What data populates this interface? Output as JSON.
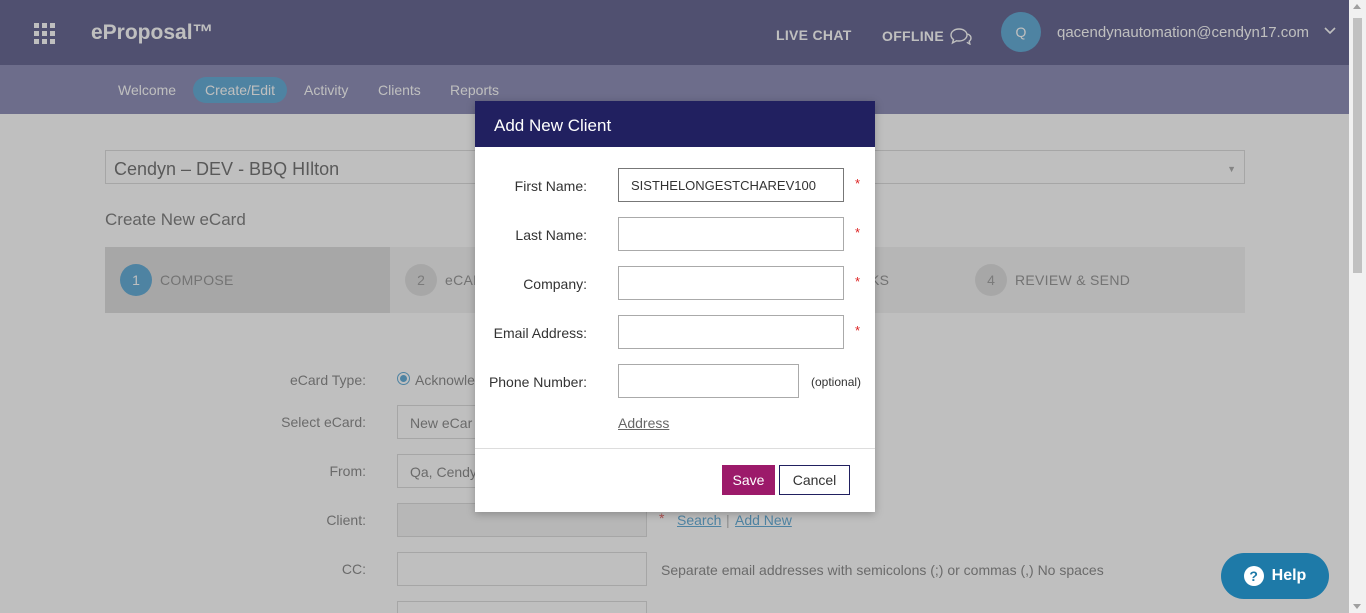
{
  "app": {
    "logo": "eProposal™"
  },
  "header": {
    "live_chat": "LIVE CHAT",
    "offline": "OFFLINE",
    "avatar_initial": "Q",
    "user_email": "qacendynautomation@cendyn17.com"
  },
  "nav": {
    "items": [
      {
        "label": "Welcome"
      },
      {
        "label": "Create/Edit",
        "active": true
      },
      {
        "label": "Activity"
      },
      {
        "label": "Clients"
      },
      {
        "label": "Reports"
      }
    ]
  },
  "property": {
    "selected": "Cendyn – DEV - BBQ HIlton"
  },
  "page": {
    "heading": "Create New eCard"
  },
  "steps": [
    {
      "num": "1",
      "label": "COMPOSE",
      "active": true
    },
    {
      "num": "2",
      "label": "eCAR"
    },
    {
      "num": "3",
      "label": "KS"
    },
    {
      "num": "4",
      "label": "REVIEW & SEND"
    }
  ],
  "form": {
    "ecard_type_label": "eCard Type:",
    "ecard_type_value": "Acknowle",
    "select_ecard_label": "Select eCard:",
    "select_ecard_value": "New eCar",
    "from_label": "From:",
    "from_value": "Qa, Cendy",
    "client_label": "Client:",
    "client_search": "Search",
    "client_separator": "|",
    "client_add_new": "Add New",
    "cc_label": "CC:",
    "cc_note": "Separate email addresses with semicolons (;) or commas (,) No spaces"
  },
  "help": {
    "label": "Help"
  },
  "modal": {
    "title": "Add New Client",
    "first_name_label": "First Name:",
    "first_name_value": "SISTHELONGESTCHAREV100",
    "last_name_label": "Last Name:",
    "company_label": "Company:",
    "email_label": "Email Address:",
    "phone_label": "Phone Number:",
    "phone_optional": "(optional)",
    "address_link": "Address",
    "save": "Save",
    "cancel": "Cancel",
    "required_mark": "*"
  },
  "colors": {
    "header_bg": "#202060",
    "modal_header_bg": "#212060",
    "accent_blue": "#1c86c4",
    "save_button": "#9c1a6a",
    "required": "#dd2222"
  }
}
